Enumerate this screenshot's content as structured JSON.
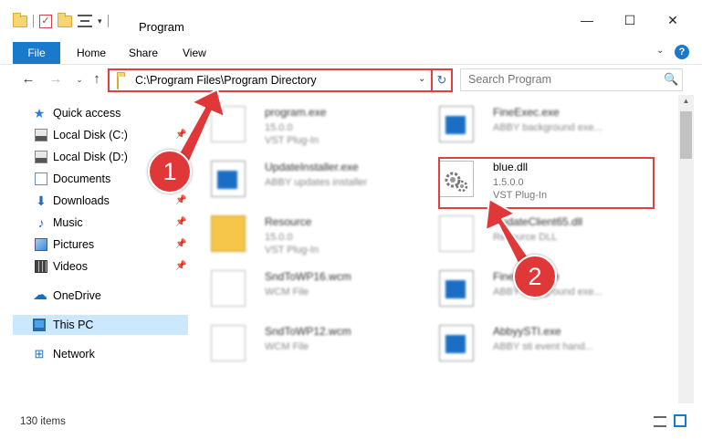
{
  "window": {
    "title": "Program",
    "controls": {
      "minimize": "—",
      "maximize": "☐",
      "close": "✕"
    }
  },
  "ribbon": {
    "tabs": [
      "File",
      "Home",
      "Share",
      "View"
    ],
    "expand": "⌄",
    "help": "?"
  },
  "nav": {
    "back": "←",
    "forward": "→",
    "recent": "⌄",
    "up": "↑"
  },
  "address": {
    "path": "C:\\Program Files\\Program Directory",
    "dropdown": "⌄",
    "refresh": "↻"
  },
  "search": {
    "placeholder": "Search Program",
    "icon": "🔍"
  },
  "sidebar": {
    "items": [
      {
        "label": "Quick access",
        "icon": "star-icon",
        "pinned": false
      },
      {
        "label": "Local Disk (C:)",
        "icon": "disk-icon",
        "pinned": true
      },
      {
        "label": "Local Disk (D:)",
        "icon": "disk-icon",
        "pinned": false
      },
      {
        "label": "Documents",
        "icon": "documents-icon",
        "pinned": true
      },
      {
        "label": "Downloads",
        "icon": "downloads-icon",
        "pinned": true
      },
      {
        "label": "Music",
        "icon": "music-icon",
        "pinned": true
      },
      {
        "label": "Pictures",
        "icon": "pictures-icon",
        "pinned": true
      },
      {
        "label": "Videos",
        "icon": "videos-icon",
        "pinned": true
      },
      {
        "label": "OneDrive",
        "icon": "onedrive-icon",
        "pinned": false
      },
      {
        "label": "This PC",
        "icon": "this-pc-icon",
        "pinned": false,
        "selected": true
      },
      {
        "label": "Network",
        "icon": "network-icon",
        "pinned": false
      }
    ],
    "pin_glyph": "📌"
  },
  "files": [
    {
      "name": "program.exe",
      "line1": "15.0.0",
      "line2": "VST Plug-In",
      "icon": "program-exe-icon"
    },
    {
      "name": "FineExec.exe",
      "line1": "ABBY background exe...",
      "line2": "",
      "icon": "exe-icon"
    },
    {
      "name": "UpdateInstaller.exe",
      "line1": "ABBY updates installer",
      "line2": "",
      "icon": "exe-icon"
    },
    {
      "name": "blue.dll",
      "line1": "1.5.0.0",
      "line2": "VST Plug-In",
      "icon": "dll-gear-icon"
    },
    {
      "name": "Resource",
      "line1": "15.0.0",
      "line2": "VST Plug-In",
      "icon": "folder-icon"
    },
    {
      "name": "UpdateClient65.dll",
      "line1": "Resource DLL",
      "line2": "",
      "icon": "dll-icon"
    },
    {
      "name": "SndToWP16.wcm",
      "line1": "WCM File",
      "line2": "",
      "icon": "file-icon"
    },
    {
      "name": "FineExec.exe",
      "line1": "ABBY background exe...",
      "line2": "",
      "icon": "exe-icon"
    },
    {
      "name": "SndToWP12.wcm",
      "line1": "WCM File",
      "line2": "",
      "icon": "file-icon"
    },
    {
      "name": "AbbyySTI.exe",
      "line1": "ABBY sti event hand...",
      "line2": "",
      "icon": "exe-icon"
    }
  ],
  "status": {
    "count": "130 items"
  },
  "annotations": {
    "step1": "1",
    "step2": "2",
    "color": "#e03838"
  }
}
